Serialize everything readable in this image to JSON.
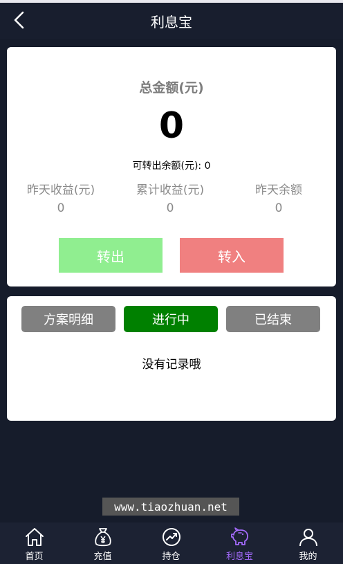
{
  "header": {
    "title": "利息宝",
    "back_icon": "chevron-left-icon"
  },
  "summary": {
    "total_label": "总金额(元)",
    "total_value": "0",
    "transferable_label": "可转出余额(元):",
    "transferable_value": "0",
    "stats": [
      {
        "label": "昨天收益(元)",
        "value": "0"
      },
      {
        "label": "累计收益(元)",
        "value": "0"
      },
      {
        "label": "昨天余额",
        "value": "0"
      }
    ],
    "transfer_out_label": "转出",
    "transfer_in_label": "转入"
  },
  "records": {
    "tabs": [
      {
        "label": "方案明细"
      },
      {
        "label": "进行中"
      },
      {
        "label": "已结束"
      }
    ],
    "empty_text": "没有记录哦"
  },
  "watermark": "www.tiaozhuan.net",
  "nav": {
    "items": [
      {
        "label": "首页",
        "icon": "home-icon"
      },
      {
        "label": "充值",
        "icon": "money-bag-icon"
      },
      {
        "label": "持仓",
        "icon": "chart-trend-icon"
      },
      {
        "label": "利息宝",
        "icon": "piggy-bank-icon"
      },
      {
        "label": "我的",
        "icon": "user-icon"
      }
    ]
  },
  "colors": {
    "background": "#161c2b",
    "transfer_out": "#90ee90",
    "transfer_in": "#f08080",
    "tab_active": "#008000",
    "tab_inactive": "#808080",
    "nav_active": "#a66cff"
  }
}
